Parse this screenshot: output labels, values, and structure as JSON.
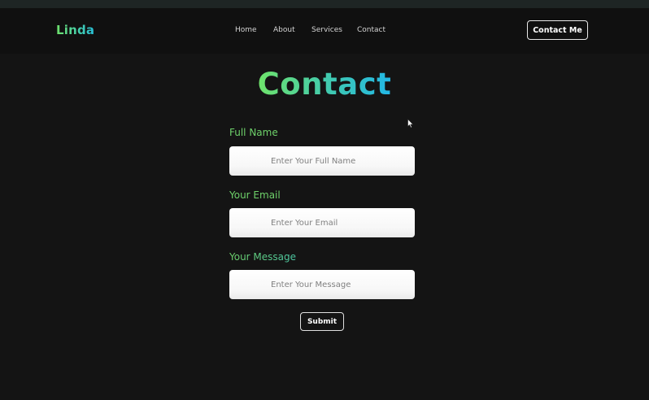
{
  "navbar": {
    "logo": "Linda",
    "links": [
      {
        "label": "Home"
      },
      {
        "label": "About"
      },
      {
        "label": "Services"
      },
      {
        "label": "Contact"
      }
    ],
    "cta_label": "Contact Me"
  },
  "page": {
    "title": "Contact"
  },
  "form": {
    "full_name": {
      "label": "Full Name",
      "placeholder": "Enter Your Full Name"
    },
    "email": {
      "label": "Your Email",
      "placeholder": "Enter Your Email"
    },
    "message": {
      "label": "Your Message",
      "placeholder": "Enter Your Message"
    },
    "submit_label": "Submit"
  },
  "colors": {
    "background": "#141414",
    "accent_green": "#6ed16a",
    "accent_cyan": "#22b7e6"
  }
}
